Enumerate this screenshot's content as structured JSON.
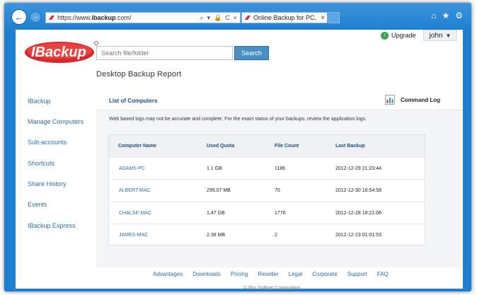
{
  "browser": {
    "url_prefix": "https://www.",
    "url_domain": "ibackup",
    "url_suffix": ".com/",
    "tab_title": "Online Backup for PC, Mac ...",
    "tab_close": "×",
    "addr_controls": [
      "⌕",
      "▾",
      "🔒",
      "C",
      "×"
    ],
    "icons": [
      "home-icon",
      "star-icon",
      "gear-icon"
    ]
  },
  "header": {
    "search_placeholder": "Search file/folder",
    "search_button": "Search",
    "upgrade_label": "Upgrade",
    "user_name": "john",
    "page_title": "Desktop Backup Report"
  },
  "sidebar": {
    "items": [
      {
        "label": "IBackup"
      },
      {
        "label": "Manage Computers"
      },
      {
        "label": "Sub-accounts"
      },
      {
        "label": "Shortcuts"
      },
      {
        "label": "Share History"
      },
      {
        "label": "Events"
      },
      {
        "label": "IBackup Express"
      }
    ]
  },
  "panel": {
    "list_title": "List of Computers",
    "command_log": "Command Log",
    "notice": "Web based logs may not be accurate and complete. For the exact status of your backups, review the application logs."
  },
  "table": {
    "headers": [
      "Computer Name",
      "Used Quota",
      "File Count",
      "Last Backup"
    ],
    "rows": [
      {
        "name": "ADAMS-PC",
        "quota": "1.1 GB",
        "files": "1186",
        "last": "2012-12-29 21:23:44"
      },
      {
        "name": "ALBERT-MAC",
        "quota": "299.07 MB",
        "files": "70",
        "last": "2012-12-30 16:54:58"
      },
      {
        "name": "CHALSE-MAC",
        "quota": "1.47 GB",
        "files": "1776",
        "last": "2012-12-28 18:21:06"
      },
      {
        "name": "JAMES-MAC",
        "quota": "2.38 MB",
        "files": "2",
        "last": "2012-12-23 01:01:53"
      }
    ]
  },
  "footer": {
    "links": [
      "Advantages",
      "Downloads",
      "Pricing",
      "Reseller",
      "Legal",
      "Corporate",
      "Support",
      "FAQ"
    ],
    "copyright": "© Pro Softnet Corporation"
  },
  "colors": {
    "chrome_blue": "#1e7fd0",
    "link_blue": "#2f6f9e",
    "logo_red": "#d7282f",
    "search_button": "#4a8fc4"
  }
}
